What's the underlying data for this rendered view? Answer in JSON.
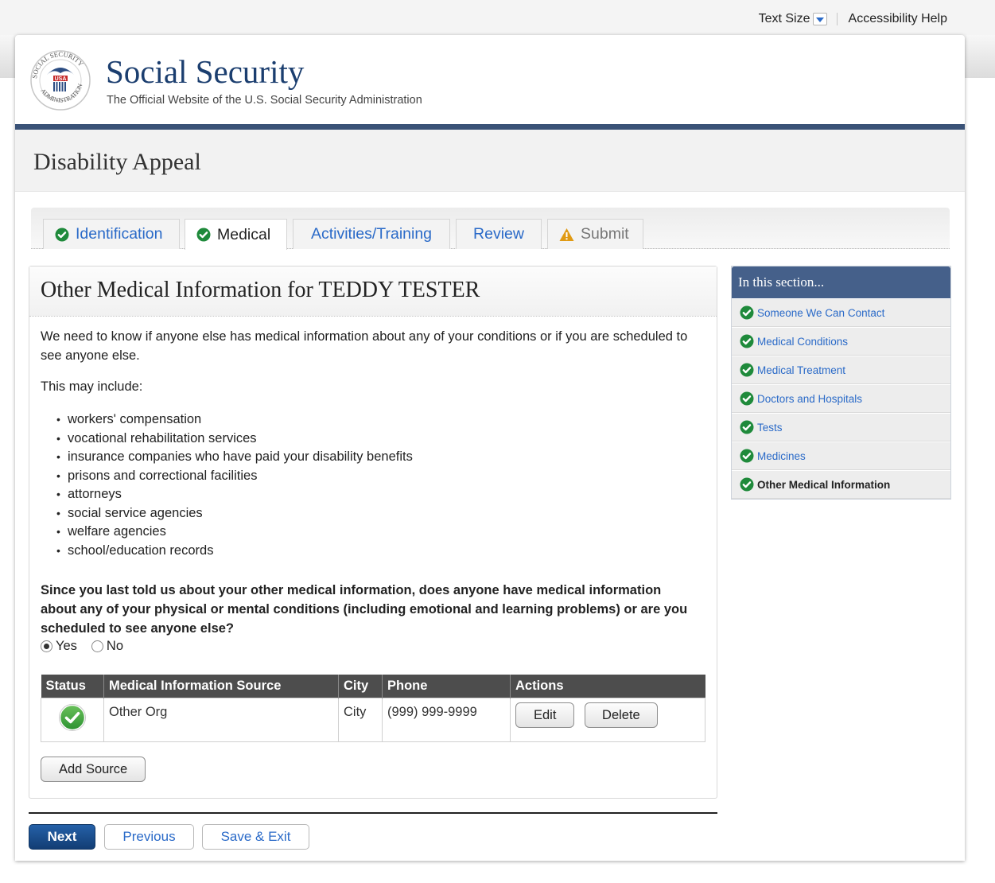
{
  "utility": {
    "text_size": "Text Size",
    "accessibility_help": "Accessibility Help"
  },
  "header": {
    "seal_text": "SOCIAL SECURITY ADMINISTRATION",
    "seal_usa": "USA",
    "title": "Social Security",
    "subtitle": "The Official Website of the U.S. Social Security Administration"
  },
  "page_title": "Disability Appeal",
  "tabs": [
    {
      "label": "Identification",
      "state": "complete"
    },
    {
      "label": "Medical",
      "state": "active-complete"
    },
    {
      "label": "Activities/Training",
      "state": "pending"
    },
    {
      "label": "Review",
      "state": "pending"
    },
    {
      "label": "Submit",
      "state": "warning"
    }
  ],
  "content": {
    "title": "Other Medical Information for TEDDY TESTER",
    "intro": "We need to know if anyone else has medical information about any of your conditions or if you are scheduled to see anyone else.",
    "may_include": "This may include:",
    "bullets": [
      "workers' compensation",
      "vocational rehabilitation services",
      "insurance companies who have paid your disability benefits",
      "prisons and correctional facilities",
      "attorneys",
      "social service agencies",
      "welfare agencies",
      "school/education records"
    ],
    "question": "Since you last told us about your other medical information, does anyone have medical information about any of your physical or mental conditions (including emotional and learning problems) or are you scheduled to see anyone else?",
    "radio_yes": "Yes",
    "radio_no": "No",
    "selected": "Yes",
    "table": {
      "headers": [
        "Status",
        "Medical Information Source",
        "City",
        "Phone",
        "Actions"
      ],
      "rows": [
        {
          "status": "complete",
          "source": "Other Org",
          "city": "City",
          "phone": "(999) 999-9999",
          "edit": "Edit",
          "delete": "Delete"
        }
      ]
    },
    "add_source": "Add Source"
  },
  "footer_nav": {
    "next": "Next",
    "previous": "Previous",
    "save_exit": "Save & Exit"
  },
  "sidebar": {
    "title": "In this section...",
    "items": [
      {
        "label": "Someone We Can Contact",
        "current": false
      },
      {
        "label": "Medical Conditions",
        "current": false
      },
      {
        "label": "Medical Treatment",
        "current": false
      },
      {
        "label": "Doctors and Hospitals",
        "current": false
      },
      {
        "label": "Tests",
        "current": false
      },
      {
        "label": "Medicines",
        "current": false
      },
      {
        "label": "Other Medical Information",
        "current": true
      }
    ]
  },
  "colors": {
    "brand_navy": "#1b3e6f",
    "rule_blue": "#3a5277",
    "link_blue": "#2a6ac8",
    "check_green": "#1f8a3b",
    "warning_orange": "#e09a13",
    "table_header": "#4d4d4d",
    "sidebar_header": "#45608a"
  },
  "icons": {
    "complete": "check-circle-icon",
    "warning": "warning-triangle-icon",
    "seal": "ssa-seal-logo"
  }
}
